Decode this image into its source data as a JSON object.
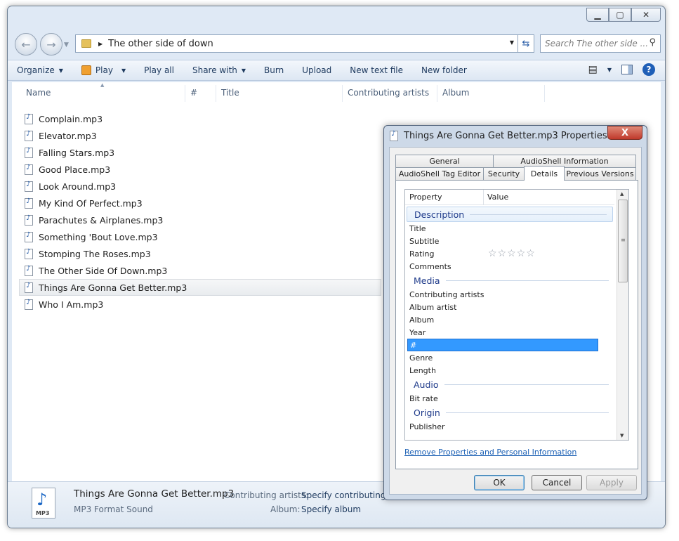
{
  "window": {
    "controls": [
      "minimize",
      "maximize",
      "close"
    ]
  },
  "nav": {
    "address_path": "The other side of down",
    "search_placeholder": "Search The other side ..."
  },
  "toolbar": {
    "organize": "Organize",
    "play": "Play",
    "play_all": "Play all",
    "share_with": "Share with",
    "burn": "Burn",
    "upload": "Upload",
    "new_text_file": "New text file",
    "new_folder": "New folder"
  },
  "columns": {
    "name": "Name",
    "number": "#",
    "title": "Title",
    "contributing_artists": "Contributing artists",
    "album": "Album"
  },
  "files": [
    "Complain.mp3",
    "Elevator.mp3",
    "Falling Stars.mp3",
    "Good Place.mp3",
    "Look Around.mp3",
    "My Kind Of Perfect.mp3",
    "Parachutes & Airplanes.mp3",
    "Something 'Bout Love.mp3",
    "Stomping The Roses.mp3",
    "The Other Side Of Down.mp3",
    "Things Are Gonna Get Better.mp3",
    "Who I Am.mp3"
  ],
  "selected_file": "Things Are Gonna Get Better.mp3",
  "details_pane": {
    "name": "Things Are Gonna Get Better.mp3",
    "type": "MP3 Format Sound",
    "icon_label": "MP3",
    "artists_label": "Contributing artists:",
    "artists_value": "Specify contributing a",
    "album_label": "Album:",
    "album_value": "Specify album"
  },
  "dialog": {
    "title": "Things Are Gonna Get Better.mp3 Properties",
    "close": "X",
    "tabs_top": [
      "General",
      "AudioShell Information"
    ],
    "tabs_bottom": [
      "AudioShell Tag Editor",
      "Security",
      "Details",
      "Previous Versions"
    ],
    "active_tab": "Details",
    "header_property": "Property",
    "header_value": "Value",
    "groups": {
      "description": "Description",
      "media": "Media",
      "audio": "Audio",
      "origin": "Origin"
    },
    "description_rows": [
      "Title",
      "Subtitle",
      "Rating",
      "Comments"
    ],
    "media_rows": [
      "Contributing artists",
      "Album artist",
      "Album",
      "Year",
      "#",
      "Genre",
      "Length"
    ],
    "audio_rows": [
      "Bit rate"
    ],
    "origin_rows": [
      "Publisher"
    ],
    "rating_stars": "☆☆☆☆☆",
    "rating_value": 0,
    "remove_link": "Remove Properties and Personal Information",
    "ok": "OK",
    "cancel": "Cancel",
    "apply": "Apply"
  }
}
